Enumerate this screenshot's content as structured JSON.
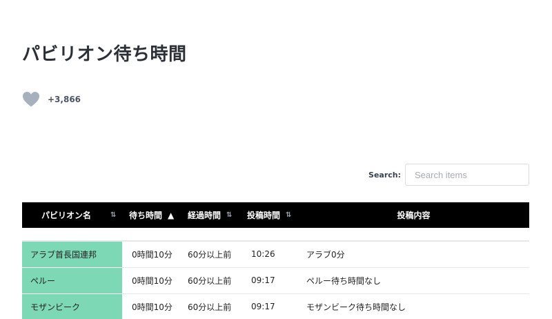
{
  "page": {
    "title": "パビリオン待ち時間"
  },
  "like": {
    "icon": "heart-icon",
    "color": "#a7b1bd",
    "count": "+3,866"
  },
  "search": {
    "label": "Search:",
    "placeholder": "Search items",
    "value": ""
  },
  "table": {
    "columns": [
      {
        "label": "パビリオン名",
        "sort": "⇅"
      },
      {
        "label": "待ち時間",
        "sort": "▲"
      },
      {
        "label": "経過時間",
        "sort": "⇅"
      },
      {
        "label": "投稿時間",
        "sort": "⇅"
      },
      {
        "label": "投稿内容",
        "sort": ""
      }
    ],
    "header_bg": "#000000",
    "name_cell_bg": "#7dd8b5",
    "rows": [
      {
        "name": "アラブ首長国連邦",
        "wait": "0時間10分",
        "elapsed": "60分以上前",
        "posted": "10:26",
        "content": "アラブ0分"
      },
      {
        "name": "ペルー",
        "wait": "0時間10分",
        "elapsed": "60分以上前",
        "posted": "09:17",
        "content": "ペルー待ち時間なし"
      },
      {
        "name": "モザンビーク",
        "wait": "0時間10分",
        "elapsed": "60分以上前",
        "posted": "09:17",
        "content": "モザンビーク待ち時間なし"
      }
    ]
  }
}
